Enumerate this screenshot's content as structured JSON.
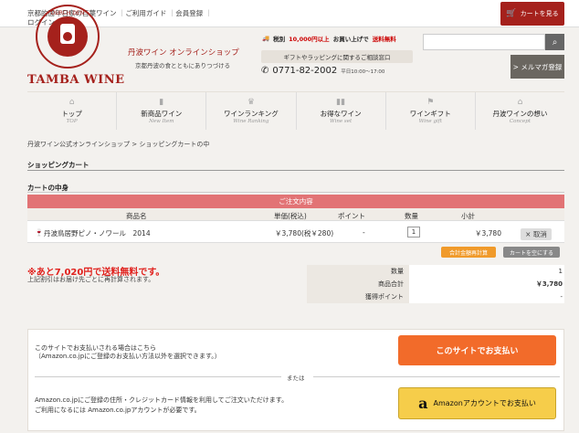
{
  "topbar": {
    "tagline": "京都的面年日家の百葉ワイン",
    "links": [
      "ご利用ガイド",
      "会員登録"
    ],
    "login": "ログイン",
    "cart_label": "カートを見る"
  },
  "header": {
    "logo_text": "TAMBA WINE",
    "shop_name": "丹波ワイン オンラインショップ",
    "shop_sub": "京都丹波の食とともにありつづける",
    "shipping_prefix": "税別",
    "shipping_amount": "10,000円以上",
    "shipping_middle": "お買い上げで",
    "shipping_free": "送料無料",
    "gift_label": "ギフトやラッピングに関するご相談窓口",
    "phone": "0771-82-2002",
    "hours": "平日10:00～17:00",
    "mailmag_label": "> メルマガ登録"
  },
  "nav": [
    {
      "jp": "トップ",
      "en": "TOP"
    },
    {
      "jp": "新商品ワイン",
      "en": "New Item"
    },
    {
      "jp": "ワインランキング",
      "en": "Wine Ranking"
    },
    {
      "jp": "お得なワイン",
      "en": "Wine set"
    },
    {
      "jp": "ワインギフト",
      "en": "Wine gift"
    },
    {
      "jp": "丹波ワインの想い",
      "en": "Concept"
    }
  ],
  "breadcrumb": "丹波ワイン公式オンラインショップ > ショッピングカートの中",
  "page_title": "ショッピングカート",
  "section_title": "カートの中身",
  "cart": {
    "header": "ご注文内容",
    "columns": [
      "商品名",
      "単価(税込)",
      "ポイント",
      "数量",
      "小計"
    ],
    "item": {
      "name": "丹波鳥居野ピノ・ノワール　2014",
      "price": "￥3,780(税￥280)",
      "points": "-",
      "qty": "1",
      "subtotal": "￥3,780",
      "delete_label": "× 取消"
    },
    "recalc_label": "合計金額再計算",
    "empty_label": "カートを空にする"
  },
  "free_shipping": {
    "message": "※あと7,020円で送料無料です。",
    "note": "上記割引はお届け先ごとに再計算されます。"
  },
  "summary": [
    {
      "key": "数量",
      "value": "1"
    },
    {
      "key": "商品合計",
      "value": "￥3,780"
    },
    {
      "key": "獲得ポイント",
      "value": "-"
    }
  ],
  "payment": {
    "site_text_1": "このサイトでお支払いされる場合はこちら",
    "site_text_2": "（Amazon.co.jpにご登録のお支払い方法以外を選択できます。）",
    "site_button": "このサイトでお支払い",
    "or_text": "または",
    "amazon_text_1": "Amazon.co.jpにご登録の住所・クレジットカード情報を利用してご注文いただけます。",
    "amazon_text_2": "ご利用になるには Amazon.co.jpアカウントが必要です。",
    "amazon_logo": "a",
    "amazon_button": "Amazonアカウントでお支払い"
  },
  "colors": {
    "brand": "#a5211c",
    "order_header": "#e27375",
    "pay_orange": "#f26b2a",
    "amazon_yellow": "#f6cd4a"
  }
}
